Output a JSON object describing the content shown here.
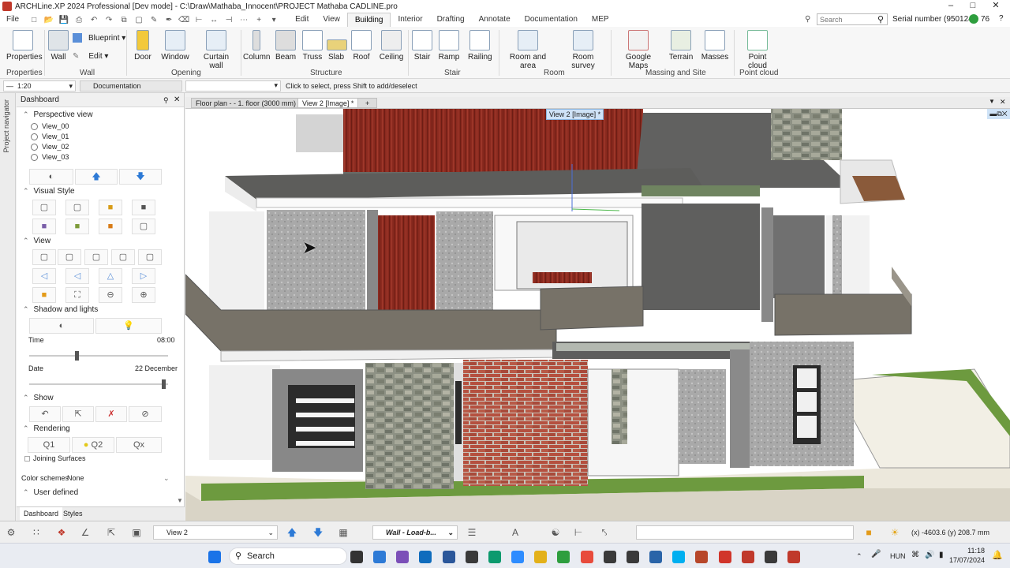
{
  "title_bar": {
    "text": "ARCHLine.XP 2024 Professional [Dev mode] - C:\\Draw\\Mathaba_Innocent\\PROJECT Mathaba CADLINE.pro",
    "minimize": "–",
    "maximize": "□",
    "close": "✕"
  },
  "menu": {
    "file": "File",
    "tabs": [
      "Edit",
      "View",
      "Building",
      "Interior",
      "Drafting",
      "Annotate",
      "Documentation",
      "MEP"
    ],
    "active_tab": "Building"
  },
  "search": {
    "placeholder": "Search"
  },
  "serial": {
    "label": "Serial number (950124)",
    "count": "76"
  },
  "ribbon": {
    "buttons": {
      "properties": "Properties",
      "wall": "Wall",
      "blueprint": "Blueprint",
      "edit": "Edit",
      "door": "Door",
      "window": "Window",
      "curtain_wall": "Curtain wall",
      "column": "Column",
      "beam": "Beam",
      "truss": "Truss",
      "slab": "Slab",
      "roof": "Roof",
      "ceiling": "Ceiling",
      "stair": "Stair",
      "ramp": "Ramp",
      "railing": "Railing",
      "room_and_area": "Room and area",
      "room_survey": "Room survey",
      "google_maps": "Google Maps",
      "terrain": "Terrain",
      "masses": "Masses",
      "point_cloud": "Point cloud"
    },
    "groups": {
      "properties": "Properties",
      "wall": "Wall",
      "opening": "Opening",
      "structure": "Structure",
      "stair": "Stair",
      "room": "Room",
      "massing": "Massing and Site",
      "point_cloud": "Point cloud"
    }
  },
  "options_bar": {
    "scale": "1:20",
    "layer": "Documentation",
    "hint": "Click to select, press Shift to add/deselect"
  },
  "left_strip": {
    "label": "Project navigator"
  },
  "dashboard": {
    "title": "Dashboard",
    "perspective": {
      "label": "Perspective view",
      "views": [
        "View_00",
        "View_01",
        "View_02",
        "View_03"
      ]
    },
    "visual_style": "Visual Style",
    "view": "View",
    "shadow": {
      "label": "Shadow and lights",
      "time_label": "Time",
      "time_value": "08:00",
      "time_level": 0.34,
      "date_label": "Date",
      "date_value": "22 December",
      "date_level": 0.98
    },
    "show": "Show",
    "rendering": {
      "label": "Rendering",
      "q1": "Q1",
      "q2": "Q2",
      "qx": "Qx"
    },
    "joining": "Joining Surfaces",
    "color_schemes": {
      "label": "Color schemes",
      "value": "None"
    },
    "user_defined": "User defined",
    "tabs": [
      "Dashboard",
      "Styles"
    ]
  },
  "view_tabs": {
    "floor_plan": "Floor plan - - 1. floor (3000 mm) *",
    "view2": "View 2 [Image] *",
    "add": "+"
  },
  "viewport": {
    "label": "View 2 [Image] *"
  },
  "status": {
    "view_select": "View 2",
    "wall_select": "Wall - Load-b...",
    "coords": "(x) -4603.6  (y) 208.7 mm"
  },
  "taskbar": {
    "search": "Search",
    "lang": "HUN",
    "time": "11:18",
    "date": "17/07/2024"
  },
  "colors": {
    "accent": "#1a6fc4",
    "roof_red": "#8b2a1f",
    "brick": "#b5503f",
    "stone": "#8a8a7a",
    "rail": "#777268",
    "grass": "#6d9a3f"
  }
}
